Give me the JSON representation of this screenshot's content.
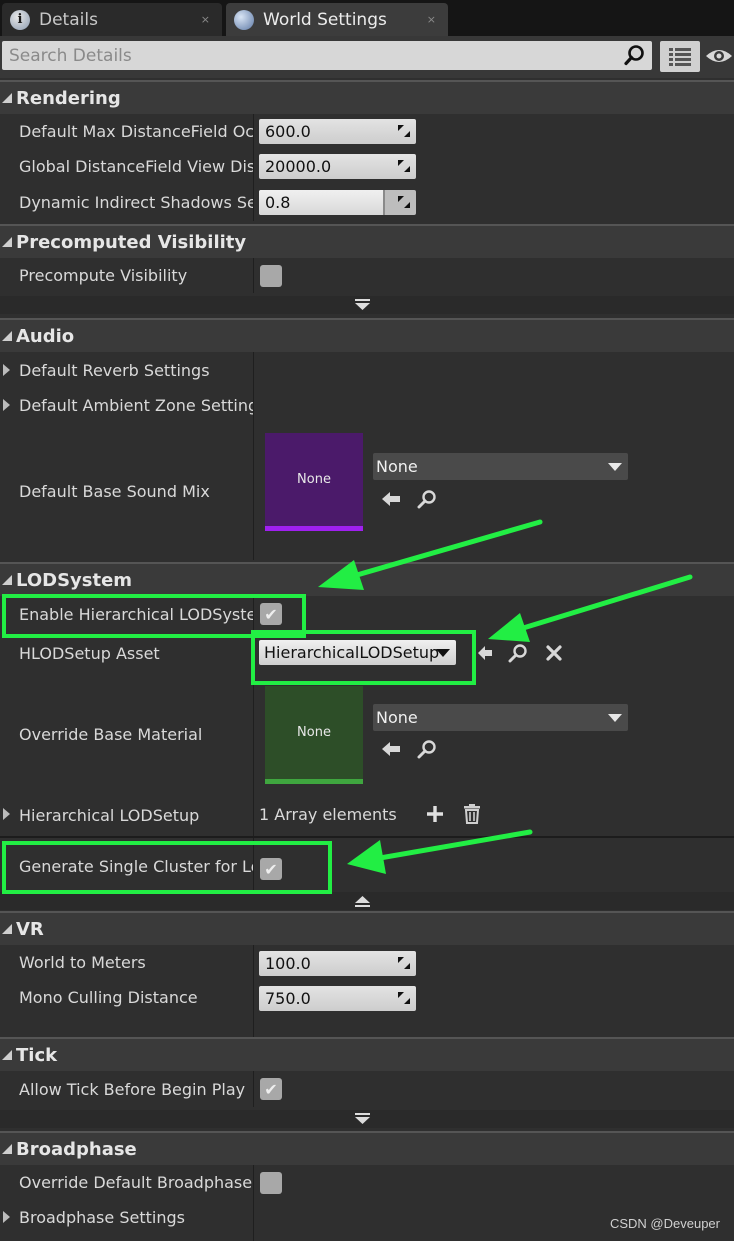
{
  "tabs": {
    "details_label": "Details",
    "world_settings_label": "World Settings",
    "close_glyph": "×"
  },
  "search": {
    "placeholder": "Search Details"
  },
  "rendering": {
    "title": "Rendering",
    "default_max_df_label": "Default Max DistanceField Occlusion",
    "default_max_df_value": "600.0",
    "global_df_label": "Global DistanceField View Distance",
    "global_df_value": "20000.0",
    "dyn_shadows_label": "Dynamic Indirect Shadows Self Shadowing Intensity",
    "dyn_shadows_value": "0.8",
    "dyn_shadows_fraction": 0.8
  },
  "precomputed_visibility": {
    "title": "Precomputed Visibility",
    "precompute_label": "Precompute Visibility",
    "precompute_checked": false
  },
  "audio": {
    "title": "Audio",
    "reverb_label": "Default Reverb Settings",
    "ambient_label": "Default Ambient Zone Settings",
    "sound_mix_label": "Default Base Sound Mix",
    "sound_mix_thumb": "None",
    "sound_mix_value": "None",
    "thumb_color": "#4b1a6a",
    "thumb_accent": "#a020f0"
  },
  "lod": {
    "title": "LODSystem",
    "enable_label": "Enable Hierarchical LODSystem",
    "enable_checked": true,
    "checkmark": "✔",
    "setup_asset_label": "HLODSetup Asset",
    "setup_asset_value": "HierarchicalLODSetup",
    "override_label": "Override Base Material",
    "override_thumb": "None",
    "override_value": "None",
    "thumb_color": "#2d4e28",
    "thumb_accent": "#3fa63f",
    "setup_array_label": "Hierarchical LODSetup",
    "setup_array_value": "1 Array elements",
    "single_cluster_label": "Generate Single Cluster for Level",
    "single_cluster_checked": true
  },
  "vr": {
    "title": "VR",
    "world_to_meters_label": "World to Meters",
    "world_to_meters_value": "100.0",
    "mono_culling_label": "Mono Culling Distance",
    "mono_culling_value": "750.0"
  },
  "tick": {
    "title": "Tick",
    "allow_tick_label": "Allow Tick Before Begin Play",
    "allow_tick_checked": true
  },
  "broadphase": {
    "title": "Broadphase",
    "override_label": "Override Default Broadphase Settings",
    "override_checked": false,
    "settings_label": "Broadphase Settings"
  },
  "highlight_color": "#22ee44",
  "watermark": "CSDN @Deveuper"
}
